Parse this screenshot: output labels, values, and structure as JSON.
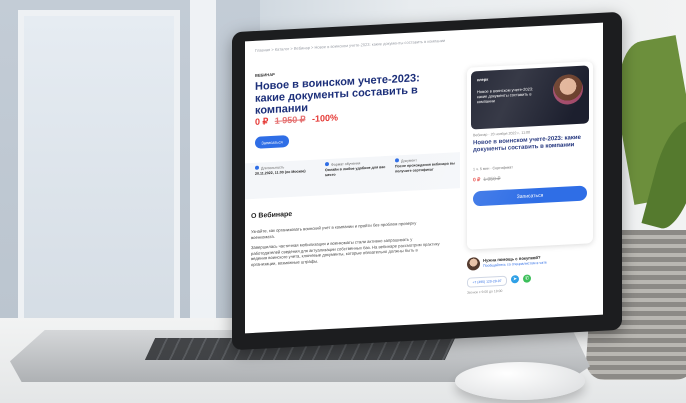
{
  "page": {
    "breadcrumb": "Главная  >  Каталог  >  Вебинар  >  Новое в воинском учете-2023: какие документы составить в компании",
    "category_label": "ВЕБИНАР",
    "title": "Новое в воинском учете-2023: какие документы составить в компании",
    "price_now": "0 ₽",
    "price_old": "1 950 ₽",
    "discount": "-100%",
    "enroll_button": "Записаться",
    "info": [
      {
        "label": "Длительность",
        "value": "20.11.2022, 11:00 (по Москве)"
      },
      {
        "label": "Формат обучения",
        "value": "Онлайн в любое удобное для вас место"
      },
      {
        "label": "Документ",
        "value": "После прохождения вебинара вы получите сертификат"
      }
    ],
    "section_title": "О Вебинаре",
    "paragraphs": [
      "Узнайте, как организовать воинский учет в компании и пройти без проблем проверку военкомата.",
      "Завершилась частичная мобилизация и военкоматы стали активно запрашивать у работодателей сведения для актуализации собственных баз. На вебинаре рассмотрим практику ведения воинского учета, ключевые документы, которые обязательно должны быть в организации, возможные штрафы."
    ]
  },
  "card": {
    "logo": "клерк",
    "banner_text": "Новое в воинском учете-2023: какие документы составить в компании",
    "meta": "Вебинар  ·  20 ноября 2022 г., 11:00",
    "title": "Новое в воинском учете-2023: какие документы составить в компании",
    "features": "1 ч. 5 мин   ·   Сертификат",
    "price_now": "0 ₽",
    "price_old": "1 950 ₽",
    "button": "Записаться"
  },
  "help": {
    "title": "Нужна помощь с покупкой?",
    "link": "Пообщайтесь со специалистом в чате",
    "phone": "+7 (495) 120-28-97",
    "hours": "Звонок с 9:00 до 18:00"
  }
}
